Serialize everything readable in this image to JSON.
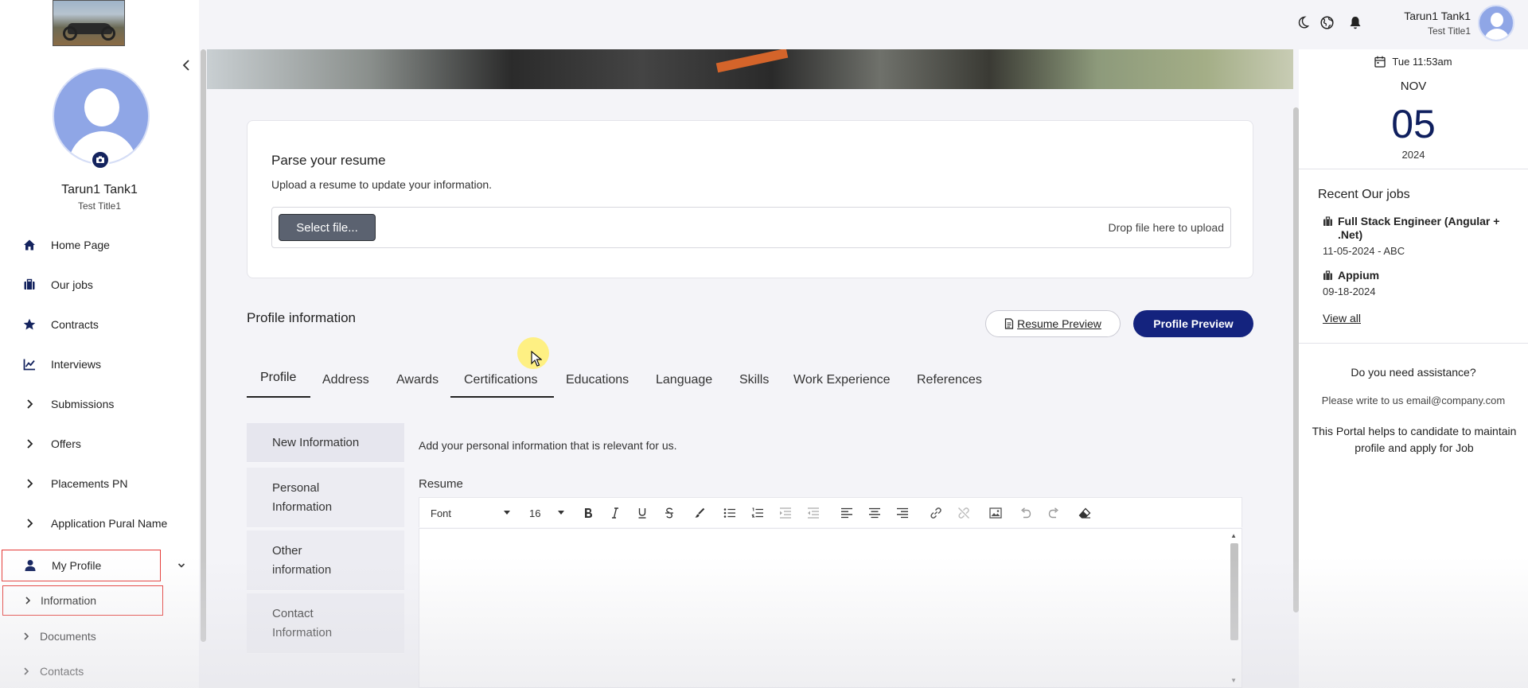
{
  "sidebar": {
    "user_name": "Tarun1 Tank1",
    "user_title": "Test Title1",
    "nav": [
      {
        "label": "Home Page",
        "icon": "home-icon"
      },
      {
        "label": "Our jobs",
        "icon": "briefcase-icon"
      },
      {
        "label": "Contracts",
        "icon": "star-icon"
      },
      {
        "label": "Interviews",
        "icon": "chart-icon"
      },
      {
        "label": "Submissions",
        "icon": "chevron-right-icon"
      },
      {
        "label": "Offers",
        "icon": "chevron-right-icon"
      },
      {
        "label": "Placements PN",
        "icon": "chevron-right-icon"
      },
      {
        "label": "Application Pural Name",
        "icon": "chevron-right-icon"
      },
      {
        "label": "My Profile",
        "icon": "person-icon"
      }
    ],
    "sub": [
      {
        "label": "Information"
      },
      {
        "label": "Documents"
      },
      {
        "label": "Contacts"
      }
    ]
  },
  "parse": {
    "title": "Parse your resume",
    "subtitle": "Upload a resume to update your information.",
    "select_label": "Select file...",
    "drop_hint": "Drop file here to upload"
  },
  "profile": {
    "title": "Profile information",
    "resume_preview": "Resume Preview",
    "profile_preview": "Profile Preview",
    "tabs": [
      "Profile",
      "Address",
      "Awards",
      "Certifications",
      "Educations",
      "Language",
      "Skills",
      "Work Experience",
      "References"
    ],
    "active_tab": "Profile",
    "subnav": [
      "New Information",
      "Personal Information",
      "Other information",
      "Contact Information"
    ],
    "section_desc": "Add your personal information that is relevant for us.",
    "resume_label": "Resume"
  },
  "editor": {
    "font_select": "Font",
    "size_select": "16"
  },
  "topbar": {
    "user_name": "Tarun1 Tank1",
    "user_title": "Test Title1"
  },
  "right_panel": {
    "time": "Tue 11:53am",
    "month": "NOV",
    "day": "05",
    "year": "2024",
    "jobs_title": "Recent Our jobs",
    "jobs": [
      {
        "title": "Full Stack Engineer (Angular + .Net)",
        "meta": "11-05-2024 - ABC"
      },
      {
        "title": "Appium",
        "meta": "09-18-2024"
      }
    ],
    "view_all": "View all",
    "assist_title": "Do you need assistance?",
    "assist_email": "Please write to us email@company.com",
    "assist_note": "This Portal helps to candidate to maintain profile and apply for Job"
  },
  "colors": {
    "accent": "#14237e",
    "highlight_border": "#e53935",
    "date_color": "#0f1f5e"
  }
}
